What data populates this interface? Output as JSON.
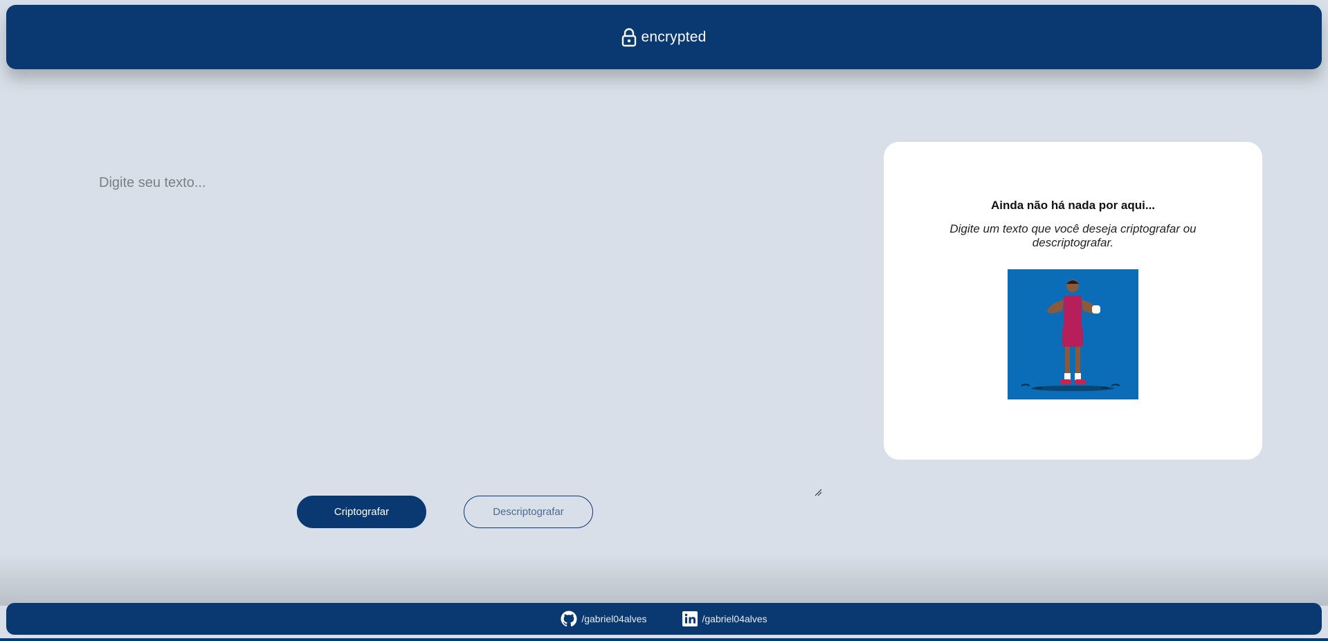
{
  "header": {
    "title": "encrypted",
    "icon": "lock-icon"
  },
  "input": {
    "placeholder": "Digite seu texto..."
  },
  "buttons": {
    "encrypt_label": "Criptografar",
    "decrypt_label": "Descriptografar"
  },
  "output": {
    "empty_title": "Ainda não há nada por aqui...",
    "empty_description": "Digite um texto que você deseja criptografar ou descriptografar."
  },
  "footer": {
    "github": {
      "icon": "github-icon",
      "label": "/gabriel04alves"
    },
    "linkedin": {
      "icon": "linkedin-icon",
      "label": "/gabriel04alves"
    }
  },
  "colors": {
    "primary": "#0a3871",
    "background": "#d8dfe8",
    "panel": "#ffffff",
    "illustration_bg": "#0b6db8"
  }
}
